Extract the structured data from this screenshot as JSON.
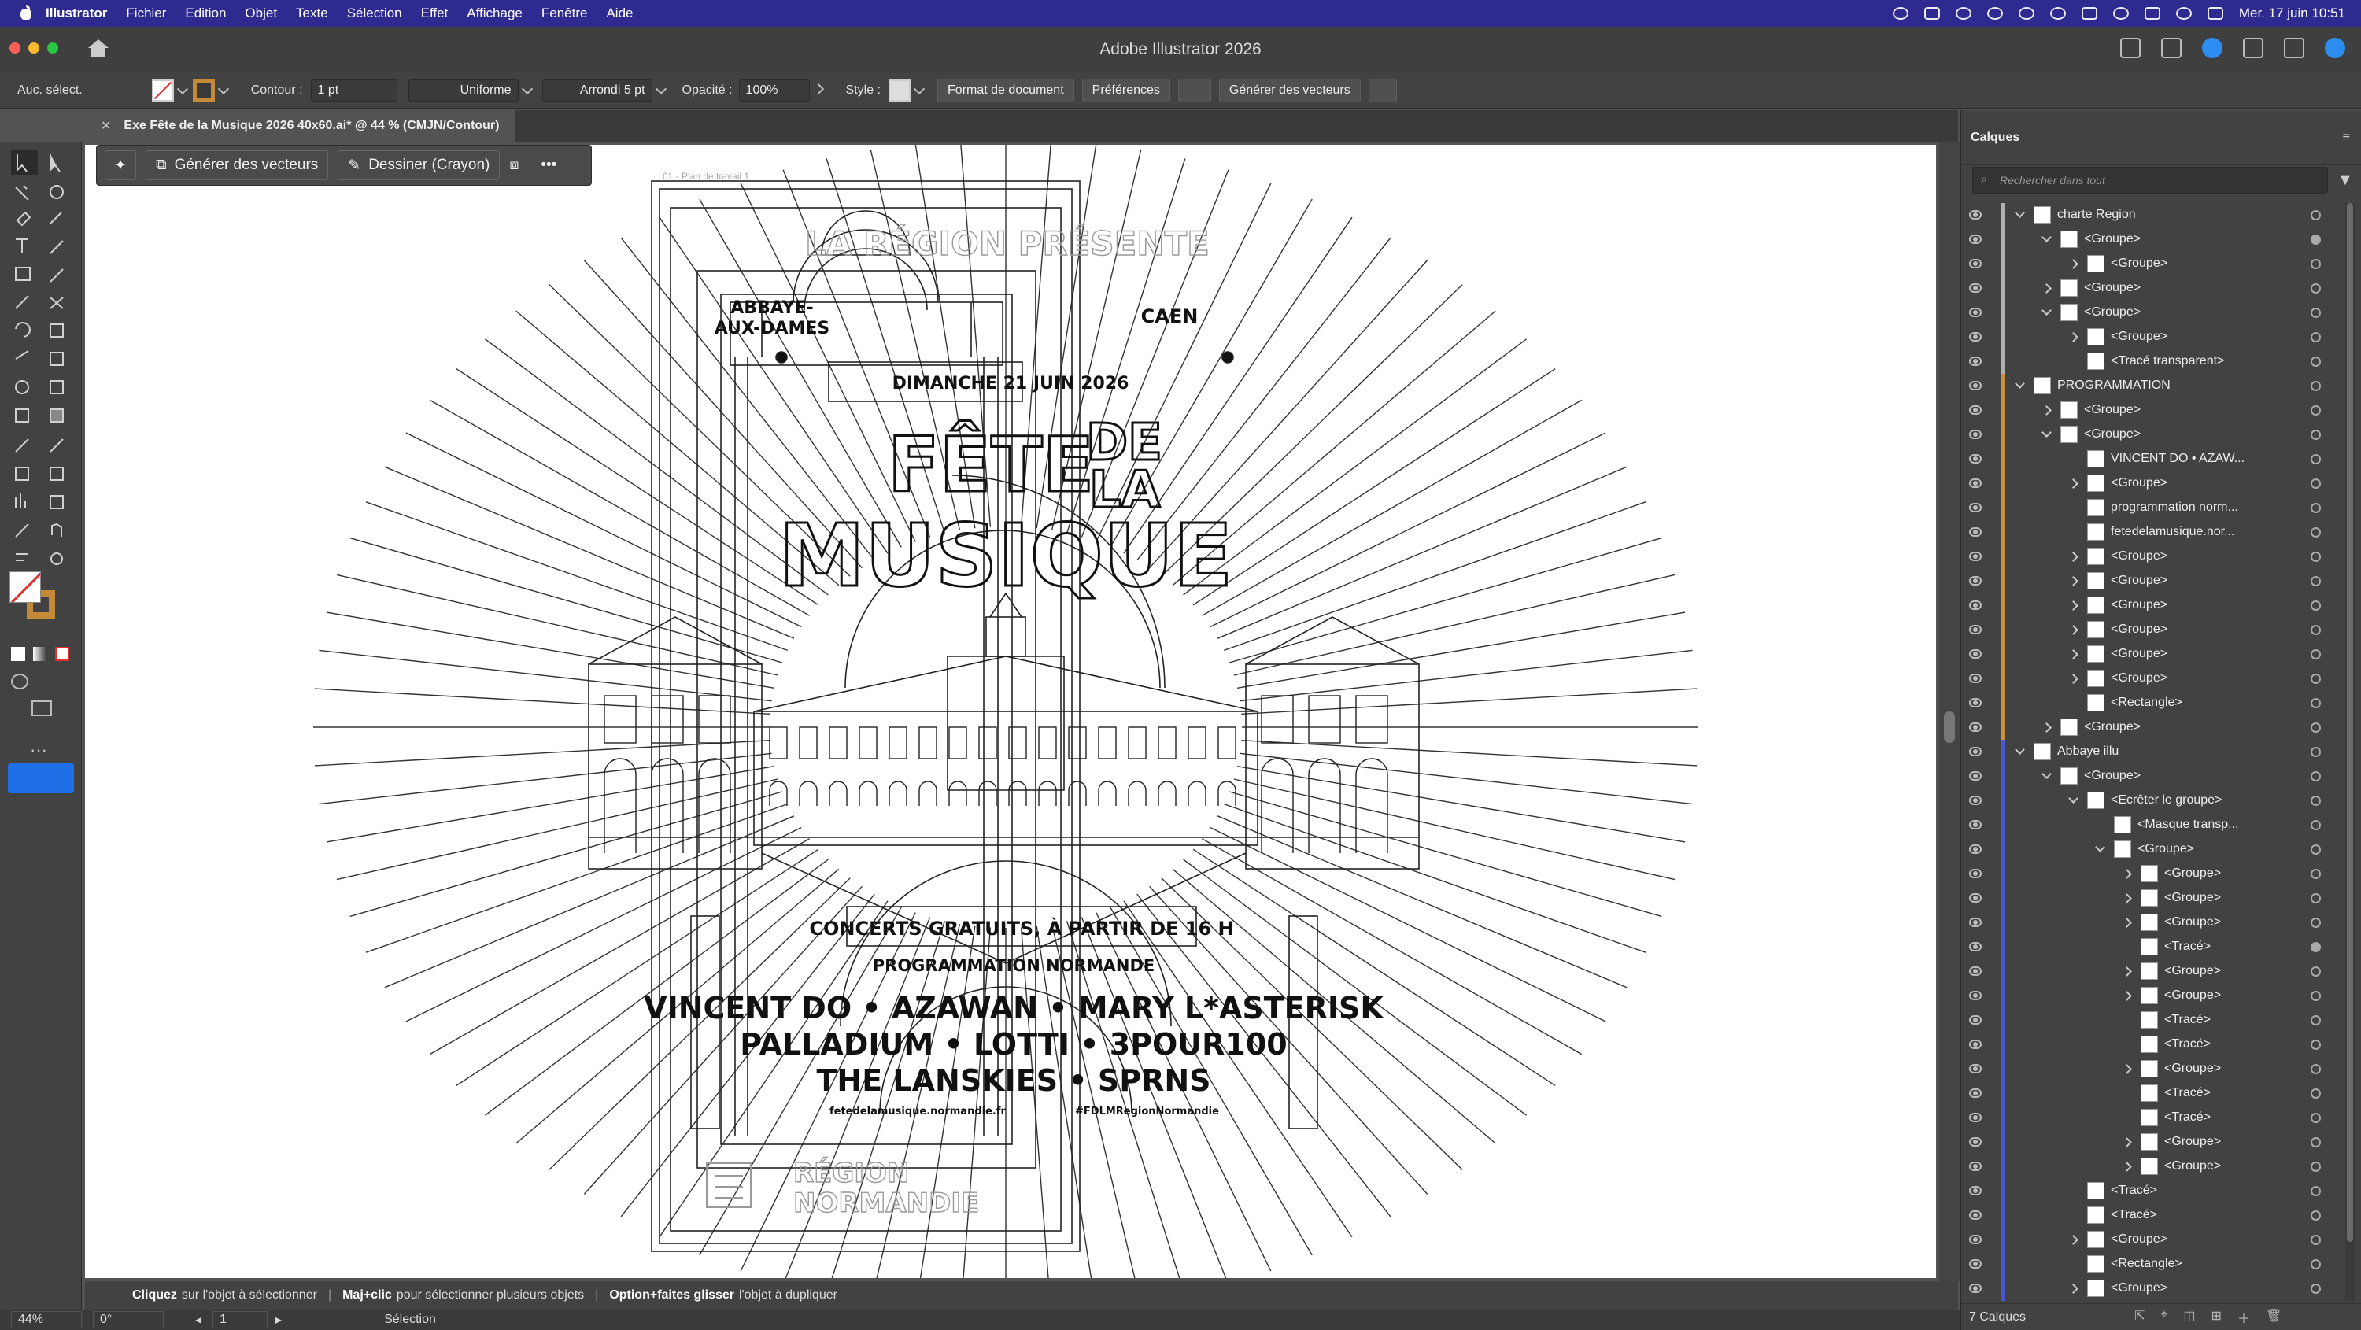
{
  "menubar": {
    "app": "Illustrator",
    "items": [
      "Fichier",
      "Edition",
      "Objet",
      "Texte",
      "Sélection",
      "Effet",
      "Affichage",
      "Fenêtre",
      "Aide"
    ],
    "clock": "Mer. 17 juin  10:51"
  },
  "window": {
    "title": "Adobe Illustrator 2026"
  },
  "control": {
    "selection": "Auc. sélect.",
    "contour_label": "Contour :",
    "contour_value": "1 pt",
    "stroke_profile": "Uniforme",
    "brush": "Arrondi 5 pt",
    "opacity_label": "Opacité :",
    "opacity_value": "100%",
    "style_label": "Style :",
    "doc_format": "Format de document",
    "preferences": "Préférences",
    "generate": "Générer des vecteurs"
  },
  "doc_tab": {
    "title": "Exe Fête de la Musique 2026 40x60.ai* @ 44 % (CMJN/Contour)"
  },
  "context_bar": {
    "generate": "Générer des vecteurs",
    "draw": "Dessiner (Crayon)"
  },
  "artboard": {
    "label": "01 - Plan de travail 1"
  },
  "poster": {
    "presents": "LA RÉGION PRÉSENTE",
    "place_left_1": "ABBAYE-",
    "place_left_2": "AUX-DAMES",
    "place_right": "CAEN",
    "date": "DIMANCHE 21 JUIN 2026",
    "title_1": "FÊTE",
    "title_2": "DE",
    "title_3": "LA",
    "title_4": "MUSIQUE",
    "concerts": "CONCERTS GRATUITS, À PARTIR DE 16 H",
    "programme": "PROGRAMMATION NORMANDE",
    "line1": "VINCENT DO • AZAWAN • MARY L*ASTERISK",
    "line2": "PALLADIUM • LOTTI • 3POUR100",
    "line3": "THE LANSKIES • SPRNS",
    "site": "fetedelamusique.normandie.fr",
    "hashtag": "#FDLMRegionNormandie",
    "region_1": "RÉGION",
    "region_2": "NORMANDIE"
  },
  "status": {
    "hint1_b": "Cliquez",
    "hint1": "sur l'objet à sélectionner",
    "hint2_b": "Maj+clic",
    "hint2": "pour sélectionner plusieurs objets",
    "hint3_b": "Option+faites glisser",
    "hint3": "l'objet à dupliquer"
  },
  "bottom": {
    "zoom": "44%",
    "angle": "0°",
    "artboard": "1",
    "tool": "Sélection"
  },
  "layers_panel": {
    "title": "Calques",
    "search_placeholder": "Rechercher dans tout",
    "count": "7 Calques",
    "rows": [
      {
        "label": "charte Region",
        "level": 0,
        "arrow": "open",
        "color": "#b0b0b0",
        "target": false
      },
      {
        "label": "<Groupe>",
        "level": 1,
        "arrow": "open",
        "color": "#b0b0b0",
        "target": true
      },
      {
        "label": "<Groupe>",
        "level": 2,
        "arrow": "closed",
        "color": "#b0b0b0",
        "target": false
      },
      {
        "label": "<Groupe>",
        "level": 1,
        "arrow": "closed",
        "color": "#b0b0b0",
        "target": false
      },
      {
        "label": "<Groupe>",
        "level": 1,
        "arrow": "open",
        "color": "#b0b0b0",
        "target": false
      },
      {
        "label": "<Groupe>",
        "level": 2,
        "arrow": "closed",
        "color": "#b0b0b0",
        "target": false
      },
      {
        "label": "<Tracé transparent>",
        "level": 2,
        "arrow": "none",
        "color": "#b0b0b0",
        "target": false
      },
      {
        "label": "PROGRAMMATION",
        "level": 0,
        "arrow": "open",
        "color": "#c9913c",
        "target": false
      },
      {
        "label": "<Groupe>",
        "level": 1,
        "arrow": "closed",
        "color": "#c9913c",
        "target": false
      },
      {
        "label": "<Groupe>",
        "level": 1,
        "arrow": "open",
        "color": "#c9913c",
        "target": false
      },
      {
        "label": "VINCENT DO • AZAW...",
        "level": 2,
        "arrow": "none",
        "color": "#c9913c",
        "target": false
      },
      {
        "label": "<Groupe>",
        "level": 2,
        "arrow": "closed",
        "color": "#c9913c",
        "target": false
      },
      {
        "label": "programmation norm...",
        "level": 2,
        "arrow": "none",
        "color": "#c9913c",
        "target": false
      },
      {
        "label": "fetedelamusique.nor...",
        "level": 2,
        "arrow": "none",
        "color": "#c9913c",
        "target": false
      },
      {
        "label": "<Groupe>",
        "level": 2,
        "arrow": "closed",
        "color": "#c9913c",
        "target": false
      },
      {
        "label": "<Groupe>",
        "level": 2,
        "arrow": "closed",
        "color": "#c9913c",
        "target": false
      },
      {
        "label": "<Groupe>",
        "level": 2,
        "arrow": "closed",
        "color": "#c9913c",
        "target": false
      },
      {
        "label": "<Groupe>",
        "level": 2,
        "arrow": "closed",
        "color": "#c9913c",
        "target": false
      },
      {
        "label": "<Groupe>",
        "level": 2,
        "arrow": "closed",
        "color": "#c9913c",
        "target": false
      },
      {
        "label": "<Groupe>",
        "level": 2,
        "arrow": "closed",
        "color": "#c9913c",
        "target": false
      },
      {
        "label": "<Rectangle>",
        "level": 2,
        "arrow": "none",
        "color": "#c9913c",
        "target": false
      },
      {
        "label": "<Groupe>",
        "level": 1,
        "arrow": "closed",
        "color": "#c9913c",
        "target": false
      },
      {
        "label": "Abbaye illu",
        "level": 0,
        "arrow": "open",
        "color": "#4a56d8",
        "target": false
      },
      {
        "label": "<Groupe>",
        "level": 1,
        "arrow": "open",
        "color": "#4a56d8",
        "target": false
      },
      {
        "label": "<Ecrêter le groupe>",
        "level": 2,
        "arrow": "open",
        "color": "#4a56d8",
        "target": false
      },
      {
        "label": "<Masque transp...",
        "level": 3,
        "arrow": "none",
        "color": "#4a56d8",
        "target": false,
        "underline": true
      },
      {
        "label": "<Groupe>",
        "level": 3,
        "arrow": "open",
        "color": "#4a56d8",
        "target": false
      },
      {
        "label": "<Groupe>",
        "level": 4,
        "arrow": "closed",
        "color": "#4a56d8",
        "target": false
      },
      {
        "label": "<Groupe>",
        "level": 4,
        "arrow": "closed",
        "color": "#4a56d8",
        "target": false
      },
      {
        "label": "<Groupe>",
        "level": 4,
        "arrow": "closed",
        "color": "#4a56d8",
        "target": false
      },
      {
        "label": "<Tracé>",
        "level": 4,
        "arrow": "none",
        "color": "#4a56d8",
        "target": true
      },
      {
        "label": "<Groupe>",
        "level": 4,
        "arrow": "closed",
        "color": "#4a56d8",
        "target": false
      },
      {
        "label": "<Groupe>",
        "level": 4,
        "arrow": "closed",
        "color": "#4a56d8",
        "target": false
      },
      {
        "label": "<Tracé>",
        "level": 4,
        "arrow": "none",
        "color": "#4a56d8",
        "target": false
      },
      {
        "label": "<Tracé>",
        "level": 4,
        "arrow": "none",
        "color": "#4a56d8",
        "target": false
      },
      {
        "label": "<Groupe>",
        "level": 4,
        "arrow": "closed",
        "color": "#4a56d8",
        "target": false
      },
      {
        "label": "<Tracé>",
        "level": 4,
        "arrow": "none",
        "color": "#4a56d8",
        "target": false
      },
      {
        "label": "<Tracé>",
        "level": 4,
        "arrow": "none",
        "color": "#4a56d8",
        "target": false
      },
      {
        "label": "<Groupe>",
        "level": 4,
        "arrow": "closed",
        "color": "#4a56d8",
        "target": false
      },
      {
        "label": "<Groupe>",
        "level": 4,
        "arrow": "closed",
        "color": "#4a56d8",
        "target": false
      },
      {
        "label": "<Tracé>",
        "level": 2,
        "arrow": "none",
        "color": "#4a56d8",
        "target": false
      },
      {
        "label": "<Tracé>",
        "level": 2,
        "arrow": "none",
        "color": "#4a56d8",
        "target": false
      },
      {
        "label": "<Groupe>",
        "level": 2,
        "arrow": "closed",
        "color": "#4a56d8",
        "target": false
      },
      {
        "label": "<Rectangle>",
        "level": 2,
        "arrow": "none",
        "color": "#4a56d8",
        "target": false
      },
      {
        "label": "<Groupe>",
        "level": 2,
        "arrow": "closed",
        "color": "#4a56d8",
        "target": false
      }
    ]
  }
}
